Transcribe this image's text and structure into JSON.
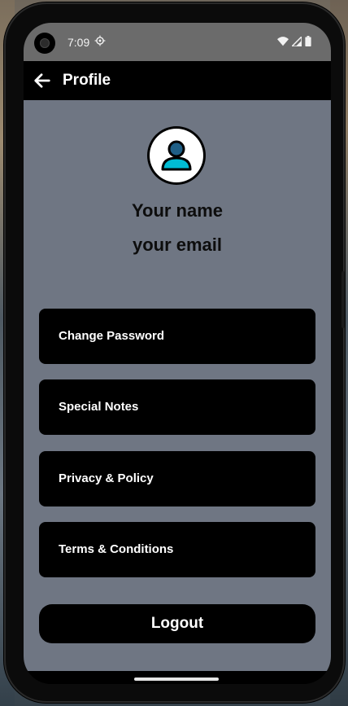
{
  "status_bar": {
    "time": "7:09",
    "icons": [
      "camera-icon",
      "settings-icon",
      "wifi-icon",
      "signal-icon",
      "battery-icon"
    ]
  },
  "app_bar": {
    "title": "Profile",
    "back_icon": "arrow-left-icon"
  },
  "profile": {
    "avatar_icon": "user-avatar-icon",
    "name": "Your name",
    "email": "your email"
  },
  "menu": {
    "items": [
      {
        "label": "Change Password"
      },
      {
        "label": "Special Notes"
      },
      {
        "label": "Privacy & Policy"
      },
      {
        "label": "Terms & Conditions"
      }
    ]
  },
  "logout": {
    "label": "Logout"
  },
  "colors": {
    "background": "#6f7683",
    "button": "#000000",
    "button_text": "#ffffff",
    "avatar_accent": "#00bcd4"
  }
}
